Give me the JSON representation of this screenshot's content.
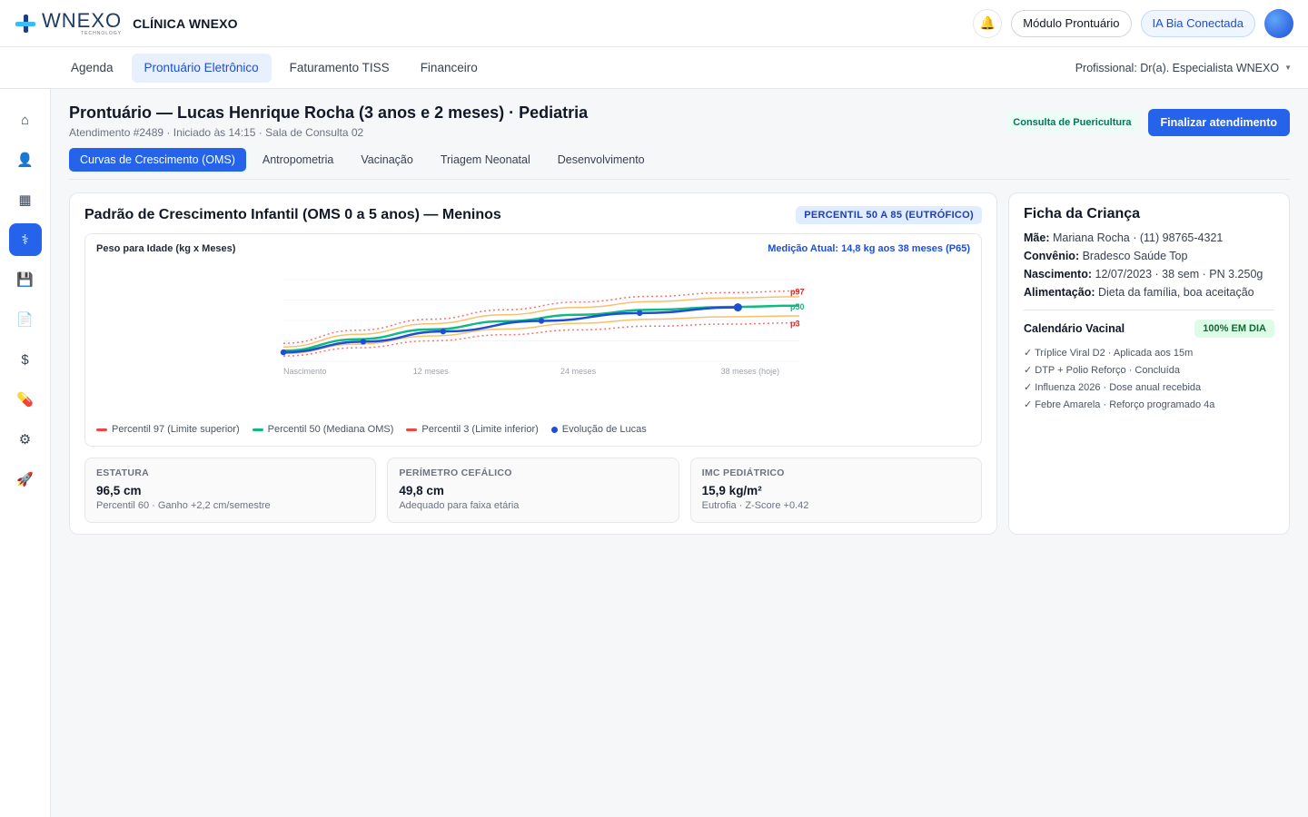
{
  "header": {
    "logo_word": "WNEXO",
    "logo_sub": "TECHNOLOGY",
    "clinic": "CLÍNICA WNEXO",
    "module_btn": "Módulo Prontuário",
    "ia_btn": "IA Bia Conectada"
  },
  "nav": {
    "items": [
      "Agenda",
      "Prontuário Eletrônico",
      "Faturamento TISS",
      "Financeiro"
    ],
    "active": "Prontuário Eletrônico",
    "professional": "Profissional: Dr(a). Especialista WNEXO"
  },
  "sidebar": {
    "icons": [
      "home-icon",
      "patient-icon",
      "calendar-icon",
      "medical-record-icon",
      "save-icon",
      "document-icon",
      "dollar-icon",
      "pill-icon",
      "gear-icon",
      "rocket-icon"
    ],
    "glyphs": [
      "⌂",
      "👤",
      "▦",
      "⚕",
      "💾",
      "📄",
      "$",
      "💊",
      "⚙",
      "🚀"
    ],
    "active_index": 3
  },
  "page": {
    "title": "Prontuário — Lucas Henrique Rocha (3 anos e 2 meses) · Pediatria",
    "subtitle": "Atendimento #2489 · Iniciado às 14:15 · Sala de Consulta 02",
    "badge": "Consulta de Puericultura",
    "finish_btn": "Finalizar atendimento"
  },
  "tabs": [
    "Curvas de Crescimento (OMS)",
    "Antropometria",
    "Vacinação",
    "Triagem Neonatal",
    "Desenvolvimento"
  ],
  "growth": {
    "title": "Padrão de Crescimento Infantil (OMS 0 a 5 anos) — Meninos",
    "badge": "PERCENTIL 50 A 85 (EUTRÓFICO)",
    "chart_label": "Peso para Idade (kg x Meses)",
    "current": "Medição Atual: 14,8 kg aos 38 meses (P65)",
    "legend": {
      "p97": "Percentil 97 (Limite superior)",
      "p50": "Percentil 50 (Mediana OMS)",
      "p3": "Percentil 3 (Limite inferior)",
      "lucas": "Evolução de Lucas"
    }
  },
  "chart_data": {
    "type": "line",
    "title": "Peso para Idade (kg x Meses)",
    "x_tick_labels": [
      "Nascimento",
      "12 meses",
      "24 meses",
      "38 meses (hoje)"
    ],
    "x_ticks": [
      0,
      12,
      24,
      38
    ],
    "xlim": [
      0,
      42
    ],
    "ylim": [
      1,
      21
    ],
    "series": [
      {
        "name": "p97",
        "style": "dotted",
        "color": "#f87171",
        "x": [
          0,
          6,
          12,
          18,
          24,
          30,
          36,
          42
        ],
        "values": [
          5.4,
          8.6,
          11.3,
          13.6,
          15.5,
          16.9,
          17.8,
          18.2
        ]
      },
      {
        "x": [
          0,
          6,
          12,
          18,
          24,
          30,
          36,
          42
        ],
        "values": [
          4.5,
          7.6,
          10.2,
          12.4,
          14.2,
          15.6,
          16.5,
          16.8
        ],
        "color": "#fbbf6b"
      },
      {
        "name": "p50",
        "color": "#10b981",
        "x": [
          0,
          6,
          12,
          18,
          24,
          30,
          36,
          42
        ],
        "values": [
          3.6,
          6.4,
          8.8,
          10.8,
          12.4,
          13.6,
          14.3,
          14.6
        ]
      },
      {
        "x": [
          0,
          6,
          12,
          18,
          24,
          30,
          36,
          42
        ],
        "values": [
          2.9,
          5.2,
          7.2,
          8.9,
          10.3,
          11.3,
          11.9,
          12.1
        ],
        "color": "#fbbf6b"
      },
      {
        "name": "p3",
        "style": "dotted",
        "color": "#f87171",
        "x": [
          0,
          6,
          12,
          18,
          24,
          30,
          36,
          42
        ],
        "values": [
          2.3,
          4.3,
          6.0,
          7.5,
          8.7,
          9.6,
          10.1,
          10.4
        ]
      },
      {
        "name": "Evolução de Lucas",
        "color": "#1d4ed8",
        "x": [
          0,
          6.5,
          13,
          21,
          29,
          37
        ],
        "values": [
          3.2,
          5.8,
          8.3,
          10.9,
          12.8,
          14.2
        ]
      }
    ]
  },
  "metrics": [
    {
      "label": "ESTATURA",
      "value": "96,5 cm",
      "note": "Percentil 60 · Ganho +2,2 cm/semestre"
    },
    {
      "label": "PERÍMETRO CEFÁLICO",
      "value": "49,8 cm",
      "note": "Adequado para faixa etária"
    },
    {
      "label": "IMC PEDIÁTRICO",
      "value": "15,9 kg/m²",
      "note": "Eutrofia · Z-Score +0.42"
    }
  ],
  "child": {
    "title": "Ficha da Criança",
    "mother_label": "Mãe:",
    "mother": "Mariana Rocha · (11) 98765-4321",
    "insurance_label": "Convênio:",
    "insurance": "Bradesco Saúde Top",
    "birth_label": "Nascimento:",
    "birth": "12/07/2023 · 38 sem · PN 3.250g",
    "feeding_label": "Alimentação:",
    "feeding": "Dieta da família, boa aceitação",
    "vac_title": "Calendário Vacinal",
    "vac_badge": "100% EM DIA",
    "vaccines": [
      "✓ Tríplice Viral D2 · Aplicada aos 15m",
      "✓ DTP + Polio Reforço · Concluída",
      "✓ Influenza 2026 · Dose anual recebida",
      "✓ Febre Amarela · Reforço programado 4a"
    ]
  }
}
